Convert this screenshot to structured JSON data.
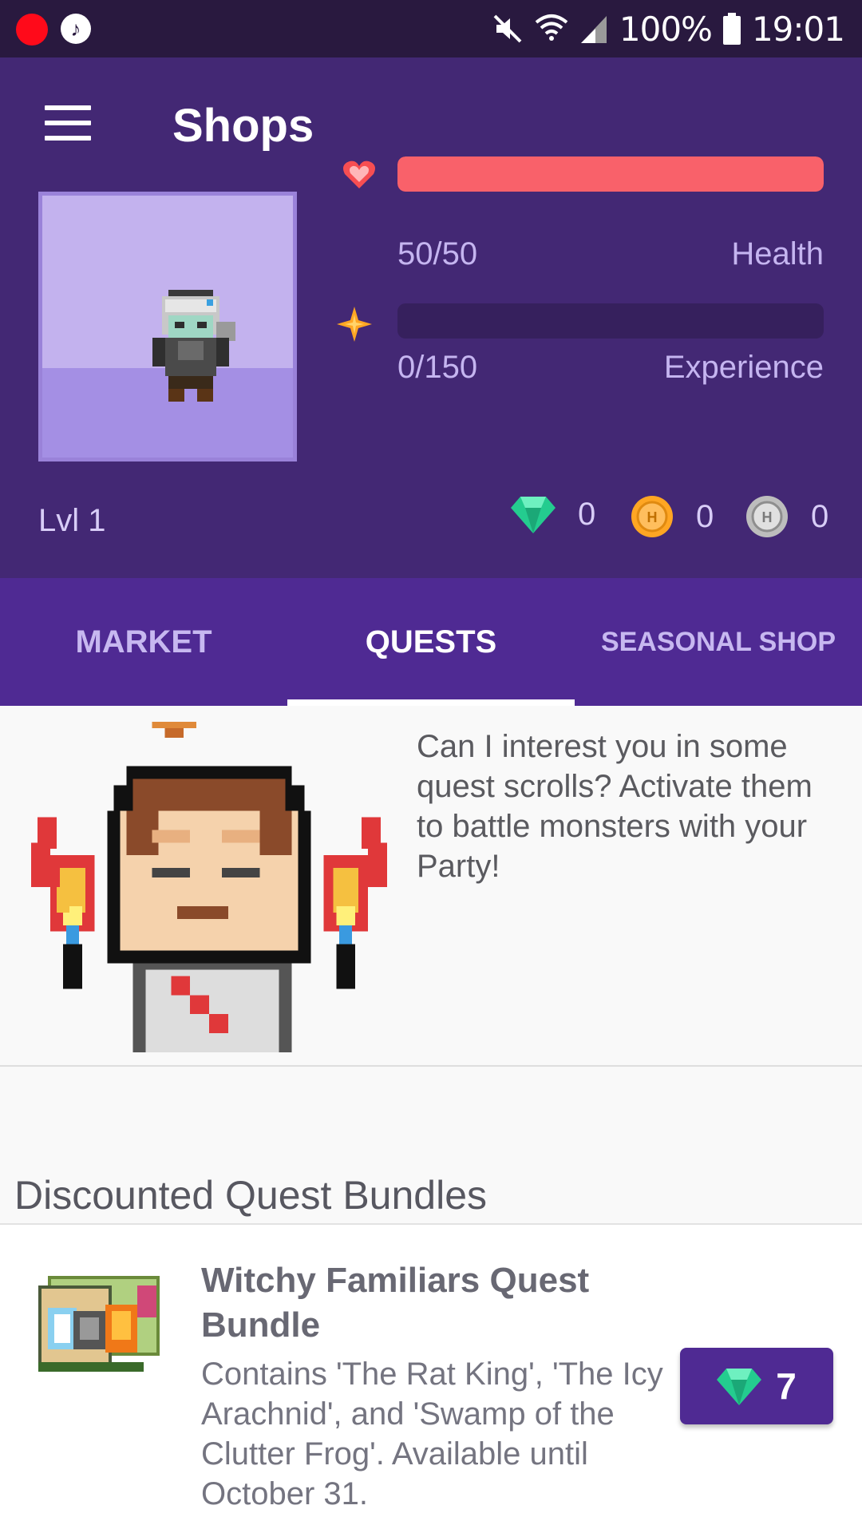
{
  "status_bar": {
    "battery": "100%",
    "time": "19:01"
  },
  "header": {
    "title": "Shops"
  },
  "stats": {
    "health": {
      "value": "50/50",
      "label": "Health",
      "fraction": 1.0
    },
    "experience": {
      "value": "0/150",
      "label": "Experience",
      "fraction": 0.0
    },
    "level": "Lvl 1",
    "gems": "0",
    "gold": "0",
    "hourglasses": "0"
  },
  "tabs": [
    {
      "label": "MARKET",
      "active": false
    },
    {
      "label": "QUESTS",
      "active": true
    },
    {
      "label": "SEASONAL SHOP",
      "active": false
    }
  ],
  "npc": {
    "message": "Can I interest you in some quest scrolls? Activate them to battle monsters with your Party!"
  },
  "section": {
    "title": "Discounted Quest Bundles"
  },
  "items": [
    {
      "title": "Witchy Familiars Quest Bundle",
      "description": "Contains 'The Rat King', 'The Icy Arachnid', and 'Swamp of the Clutter Frog'. Available until October 31.",
      "price": "7"
    }
  ],
  "colors": {
    "header": "#432874",
    "tabs": "#4f2a93",
    "health": "#f9616a",
    "gem": "#24cc8f",
    "gold": "#ffa623"
  },
  "icons": [
    "menu-icon",
    "heart-icon",
    "star-icon",
    "gem-icon",
    "gold-coin-icon",
    "hourglass-icon",
    "mute-icon",
    "wifi-icon",
    "signal-icon",
    "battery-icon"
  ]
}
